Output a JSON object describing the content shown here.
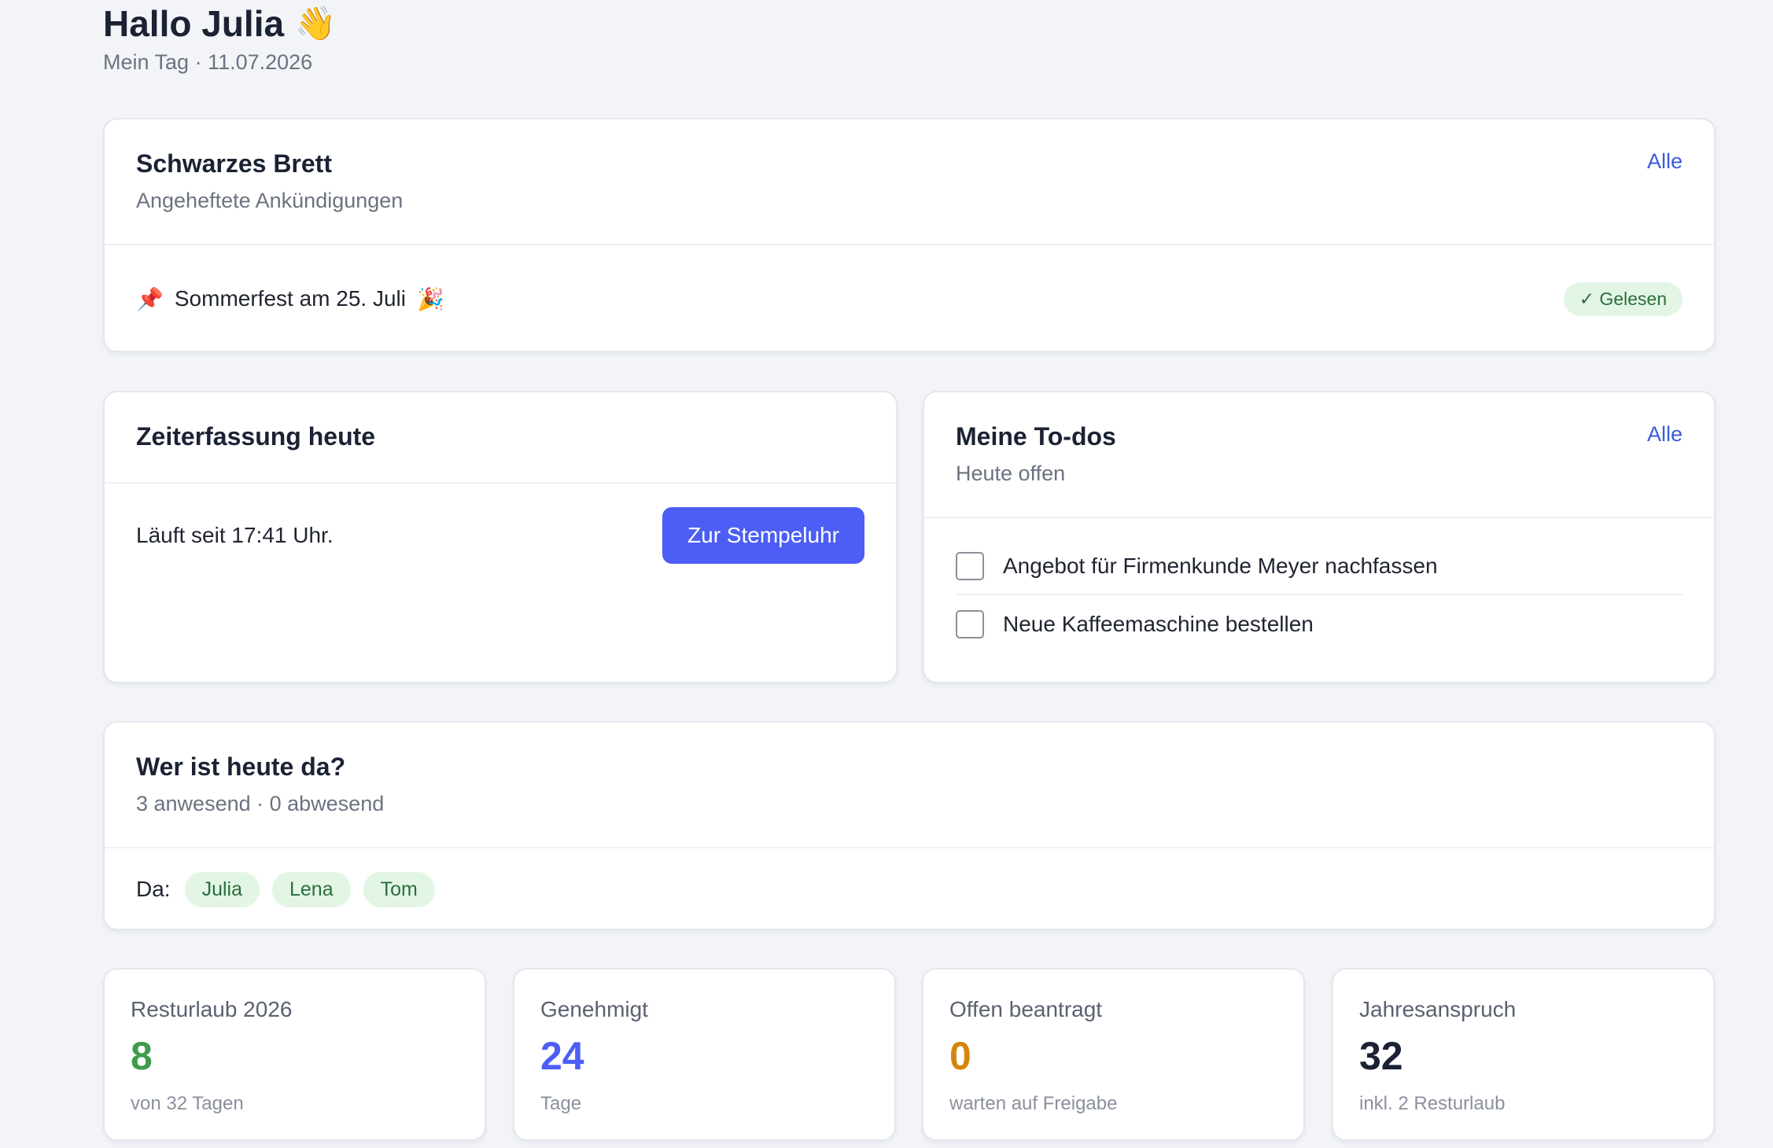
{
  "header": {
    "greeting": "Hallo Julia",
    "wave_emoji": "👋",
    "subline": "Mein Tag · 11.07.2026"
  },
  "board": {
    "title": "Schwarzes Brett",
    "subtitle": "Angeheftete Ankündigungen",
    "all_link": "Alle",
    "pin_icon": "📌",
    "item_text": "Sommerfest am 25. Juli",
    "item_emoji": "🎉",
    "status": "✓ Gelesen"
  },
  "time_tracking": {
    "title": "Zeiterfassung heute",
    "status_text": "Läuft seit 17:41 Uhr.",
    "button_label": "Zur Stempeluhr"
  },
  "todos": {
    "title": "Meine To-dos",
    "subtitle": "Heute offen",
    "all_link": "Alle",
    "items": [
      {
        "label": "Angebot für Firmenkunde Meyer nachfassen",
        "done": false
      },
      {
        "label": "Neue Kaffeemaschine bestellen",
        "done": false
      }
    ]
  },
  "presence": {
    "title": "Wer ist heute da?",
    "subtitle": "3 anwesend · 0 abwesend",
    "label": "Da:",
    "people": [
      "Julia",
      "Lena",
      "Tom"
    ]
  },
  "stats": [
    {
      "label": "Resturlaub 2026",
      "value": "8",
      "note": "von 32 Tagen",
      "color": "#3f9b4a"
    },
    {
      "label": "Genehmigt",
      "value": "24",
      "note": "Tage",
      "color": "#4c5ef5"
    },
    {
      "label": "Offen beantragt",
      "value": "0",
      "note": "warten auf Freigabe",
      "color": "#d4860b"
    },
    {
      "label": "Jahresanspruch",
      "value": "32",
      "note": "inkl. 2 Resturlaub",
      "color": "#1a2233"
    }
  ],
  "colors": {
    "accent": "#4c5ef5",
    "link": "#3b5bdb",
    "success_bg": "#e3f6e6",
    "success_text": "#2b6e3a",
    "background": "#f2f4f8"
  }
}
